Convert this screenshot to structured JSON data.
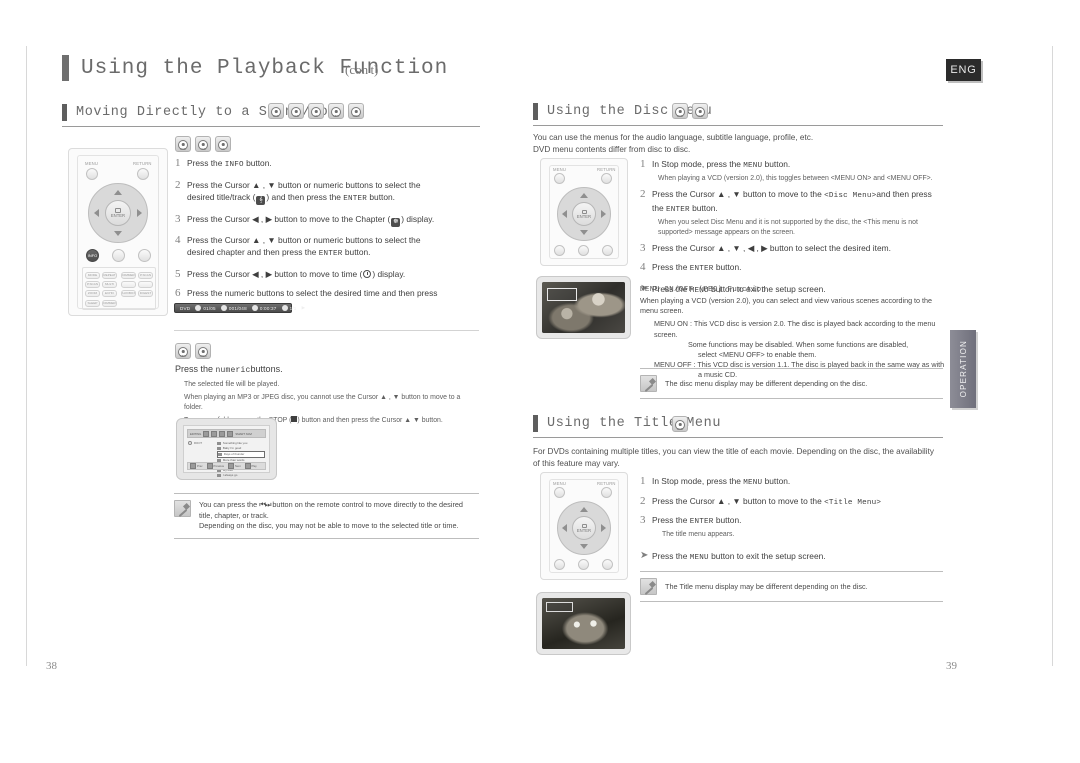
{
  "header": {
    "chapter_title": "Using the Playback Function",
    "continued": "(con't)",
    "language_badge": "ENG"
  },
  "side_tab": {
    "label": "OPERATION"
  },
  "page_numbers": {
    "left": "38",
    "right": "39"
  },
  "left_column": {
    "section": {
      "heading": "Moving Directly to a Scene/Song",
      "disc_chips": [
        {
          "label": "DVD"
        },
        {
          "label": "VCD"
        },
        {
          "label": "CD"
        },
        {
          "label": "MP3"
        },
        {
          "label": "JPEG"
        }
      ]
    },
    "group_chips": [
      {
        "label": "DVD"
      },
      {
        "label": "VCD"
      },
      {
        "label": "CD"
      }
    ],
    "steps": [
      {
        "num": "1",
        "text": "Press the INFO button."
      },
      {
        "num": "2",
        "text": "Press the Cursor ▲ , ▼ button or numeric buttons to select the desired title/track (  ) and then press the ENTER  button."
      },
      {
        "num": "3",
        "text": "Press the Cursor ◀ , ▶ button to move to the Chapter (  ) display."
      },
      {
        "num": "4",
        "text": "Press the Cursor ▲ , ▼ button or numeric buttons to select the desired chapter and then press the ENTER  button."
      },
      {
        "num": "5",
        "text": "Press the Cursor ◀ , ▶ button to move to time (  ) display."
      },
      {
        "num": "6",
        "text": "Press the numeric buttons to select the desired time and then press the ENTER  button."
      }
    ],
    "osd_bar": {
      "disc_type": "DVD",
      "title_value": "01/05",
      "chapter_value": "001/048",
      "time_value": "0:00:37",
      "audio_value": "1/1"
    },
    "mp3_group": {
      "chips": [
        {
          "label": "MP3"
        },
        {
          "label": "JPEG"
        }
      ],
      "instruction_prefix": "Press the ",
      "instruction_mono": "numeric",
      "instruction_suffix": "buttons.",
      "notes": [
        "The selected file will be played.",
        "When playing an MP3 or JPEG disc, you cannot use the Cursor ▲ , ▼ button to move to a folder.",
        "To move a folder, press the STOP (  ) button and then press the Cursor ▲  ▼ button."
      ]
    },
    "mp3_screen": {
      "title": "EDITING",
      "mode_label": "SMART NAVI",
      "left_label": "ROOT",
      "tracks": [
        "Something like you",
        "Baby I'm good",
        "Days of thunder",
        "More than words",
        "I need you",
        "My love",
        "I always go"
      ],
      "selected_index": 2,
      "footer": [
        "Prev",
        "Previous",
        "Next",
        "Play"
      ]
    },
    "note": {
      "lines": [
        "You can press the  ⏮ ⏭  button on the remote control to move directly to the desired title, chapter, or track.",
        "Depending on the disc, you may not be able to move to the selected title or time."
      ]
    }
  },
  "right_column": {
    "disc_menu": {
      "heading": "Using the Disc Menu",
      "disc_chips": [
        {
          "label": "DVD"
        },
        {
          "label": "VCD"
        }
      ],
      "intro": [
        "You can use the menus for the audio language, subtitle language, profile, etc.",
        "DVD menu contents differ from disc to disc."
      ],
      "steps": [
        {
          "num": "1",
          "text": "In Stop mode, press the MENU  button.",
          "sub": "When playing a VCD (version 2.0), this toggles between <MENU ON> and <MENU OFF>."
        },
        {
          "num": "2",
          "text": "Press the Cursor ▲ , ▼ button to move to the <Disc Menu>and then press the ENTER  button.",
          "sub": "When you select Disc Menu and it is not supported by the disc, the <This menu is not supported> message appears on the screen."
        },
        {
          "num": "3",
          "text": "Press the Cursor ▲ , ▼ , ◀ , ▶ button to select the desired item.",
          "sub": ""
        },
        {
          "num": "4",
          "text": "Press the ENTER  button.",
          "sub": ""
        }
      ],
      "exit_step": {
        "num": "➤",
        "text": "Press the MENU  button to exit the setup screen."
      },
      "menu_onoff": {
        "title": "MENU ON/OFF (PBC) Function",
        "description": "When playing a VCD (version 2.0), you can select and view various scenes according to the menu screen.",
        "menu_on_label": "MENU ON :",
        "menu_on_lines": [
          "This VCD disc is version 2.0. The disc is played back according to the menu screen.",
          "Some functions may be disabled. When some functions are disabled,",
          "select <MENU OFF> to enable them."
        ],
        "menu_off_label": "MENU OFF :",
        "menu_off_lines": [
          "This VCD disc is version 1.1. The disc is played back in the same way as with",
          "a music CD."
        ]
      },
      "note": "The disc menu display may be different depending on the disc."
    },
    "title_menu": {
      "heading": "Using the Title Menu",
      "disc_chips": [
        {
          "label": "DVD"
        }
      ],
      "intro": "For DVDs containing multiple titles, you can view the title of each movie. Depending on the disc, the availability of this feature may vary.",
      "steps": [
        {
          "num": "1",
          "text": "In Stop mode, press the MENU  button.",
          "sub": ""
        },
        {
          "num": "2",
          "text": "Press the Cursor ▲ , ▼ button to move to the <Title Menu>",
          "sub": ""
        },
        {
          "num": "3",
          "text": "Press the ENTER  button.",
          "sub": "The title menu appears."
        }
      ],
      "exit_step": {
        "num": "➤",
        "text": "Press the MENU  button to exit the setup screen."
      },
      "note": "The Title menu display may be different depending on the disc."
    }
  },
  "remote": {
    "menu_label": "MENU",
    "return_label": "RETURN",
    "enter_label": "ENTER",
    "info_label": "INFO",
    "aux_label": "AUX",
    "power_label": "",
    "keypad_labels": [
      "SOUND",
      "REPEAT",
      "DIMMER",
      "P.SCAN",
      "MODE",
      "S.VOL",
      "LOGO",
      "REMAIN",
      "P.SCAN",
      "MULTI",
      "",
      "",
      "ZOOM",
      "ECHO",
      "AUX/BOX",
      "DIGEST",
      "",
      "INTRO",
      "",
      "",
      "SLEEP",
      "DIMMER",
      "",
      ""
    ]
  }
}
